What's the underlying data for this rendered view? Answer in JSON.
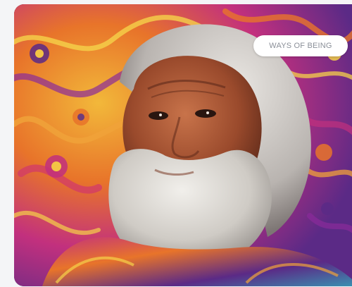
{
  "card": {
    "tag_label": "WAYS OF BEING",
    "image_subject": "portrait-artwork"
  },
  "colors": {
    "page_background": "#f4f5f7",
    "tag_background": "#ffffff",
    "tag_text": "#8a8f98",
    "art_orange": "#e8742a",
    "art_magenta": "#c2307e",
    "art_purple": "#5b2a86",
    "art_yellow": "#f2b83a",
    "beard_gray": "#d8d6d2"
  }
}
